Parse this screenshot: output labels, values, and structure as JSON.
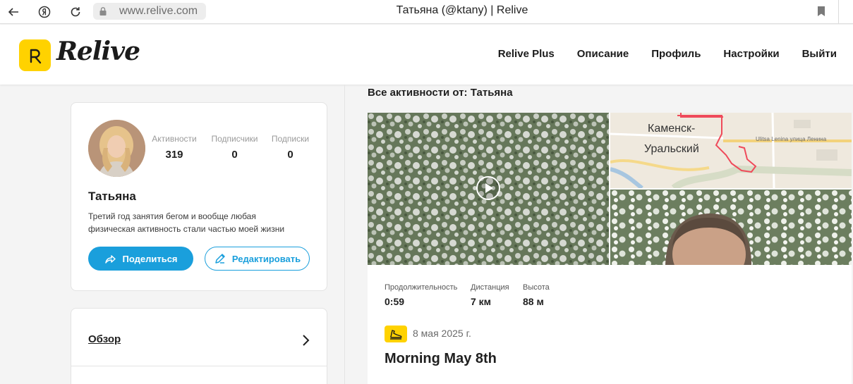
{
  "browser": {
    "address": "www.relive.com",
    "page_title": "Татьяна (@ktany) | Relive",
    "icons": [
      "back-arrow-icon",
      "yandex-logo-icon",
      "refresh-icon",
      "lock-icon",
      "bookmark-icon"
    ]
  },
  "header": {
    "logo_text": "Relive",
    "nav": [
      {
        "label": "Relive Plus"
      },
      {
        "label": "Описание"
      },
      {
        "label": "Профиль"
      },
      {
        "label": "Настройки"
      },
      {
        "label": "Выйти"
      }
    ],
    "brand_color": "#ffd200"
  },
  "profile": {
    "name": "Татьяна",
    "bio": "Третий год занятия бегом и вообще любая физическая активность стали частью моей жизни",
    "stats": [
      {
        "label": "Активности",
        "value": "319"
      },
      {
        "label": "Подписчики",
        "value": "0"
      },
      {
        "label": "Подписки",
        "value": "0"
      }
    ],
    "share_label": "Поделиться",
    "edit_label": "Редактировать",
    "accent_color": "#1a9fdc"
  },
  "sidebar": {
    "overview_label": "Обзор"
  },
  "feed": {
    "title": "Все активности от: Татьяна",
    "activity": {
      "map_labels": {
        "city_line1": "Каменск-",
        "city_line2": "Уральский",
        "street": "Ulitsa Lenina улица Ленина"
      },
      "metrics": [
        {
          "label": "Продолжительность",
          "value": "0:59"
        },
        {
          "label": "Дистанция",
          "value": "7 км"
        },
        {
          "label": "Высота",
          "value": "88 м"
        }
      ],
      "sport_icon": "running-shoe-icon",
      "date": "8 мая 2025 г.",
      "name": "Morning May 8th"
    }
  }
}
